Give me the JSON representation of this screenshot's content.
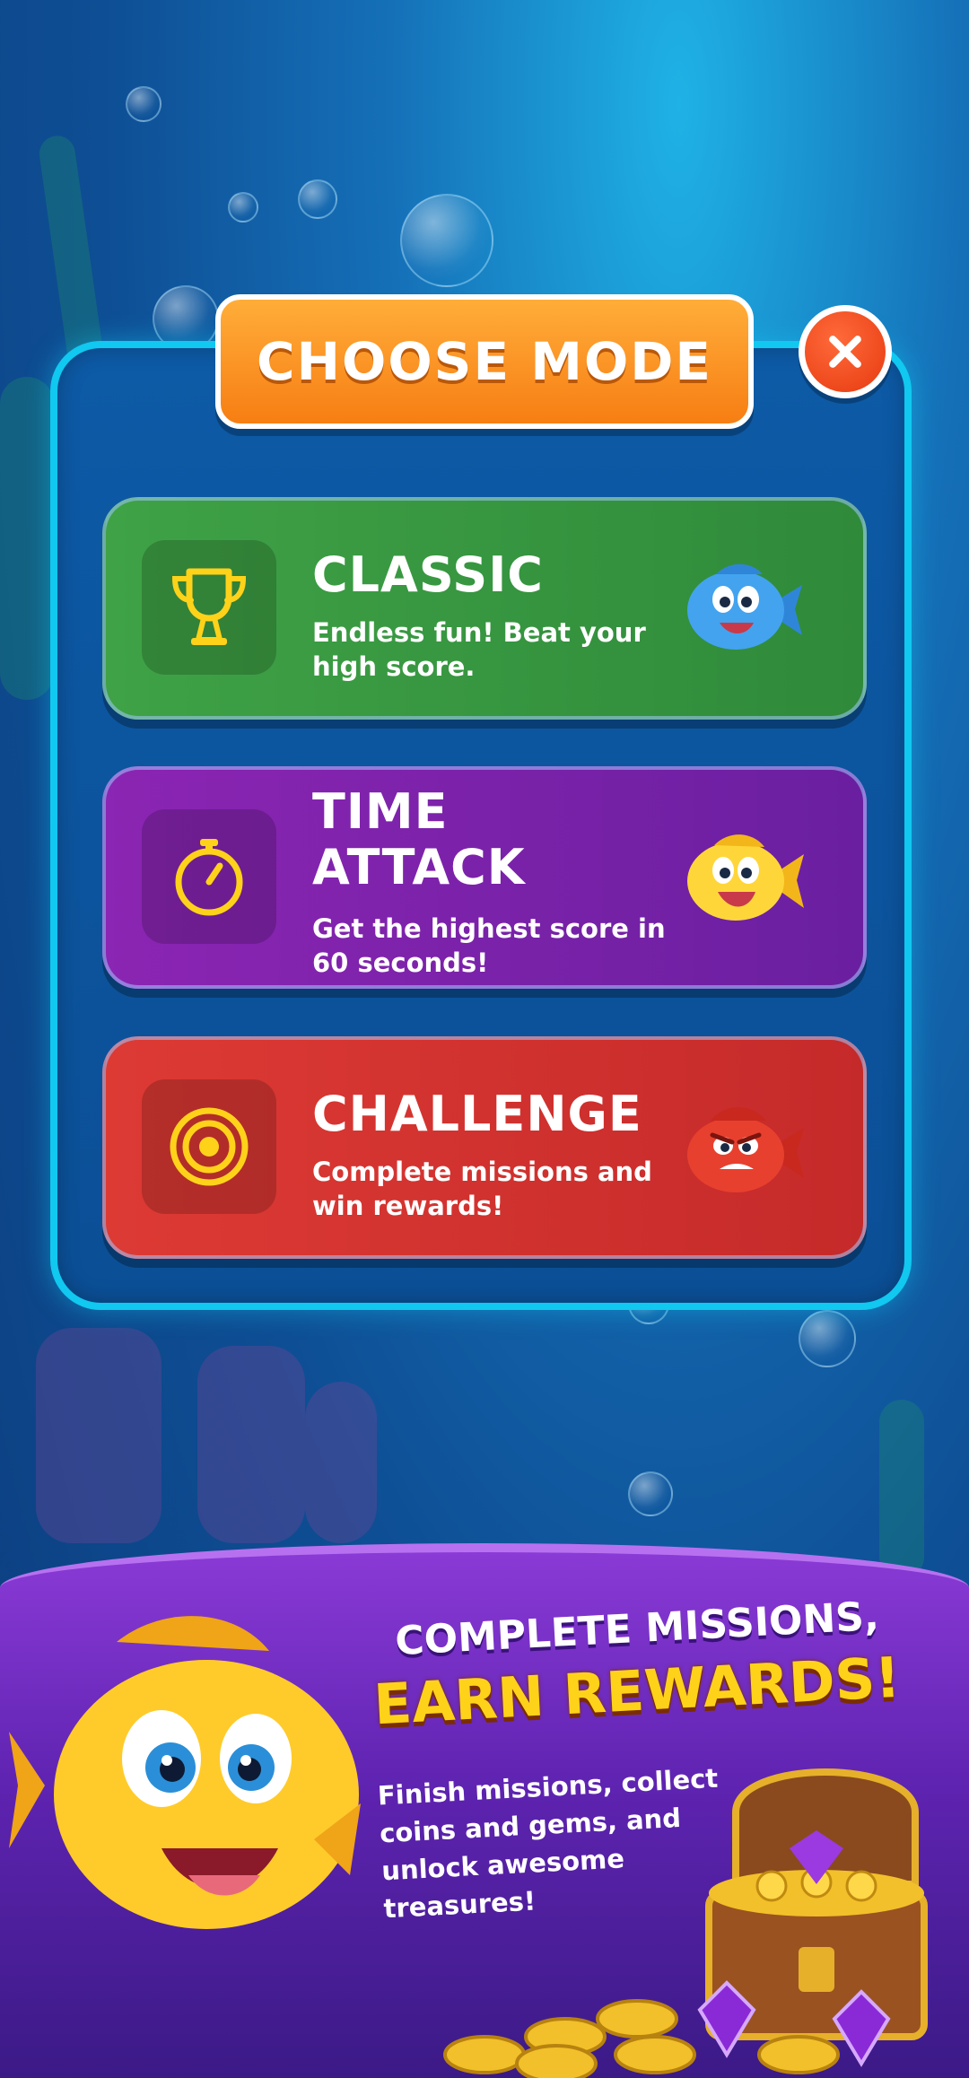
{
  "modal": {
    "title": "CHOOSE MODE",
    "close_icon": "close-icon"
  },
  "modes": [
    {
      "key": "classic",
      "title": "CLASSIC",
      "description": "Endless fun! Beat your high score.",
      "icon": "trophy-icon",
      "fish": "blue-fish",
      "color": "#3fa246"
    },
    {
      "key": "time",
      "title": "TIME\nATTACK",
      "description": "Get the highest score in 60 seconds!",
      "icon": "stopwatch-icon",
      "fish": "yellow-fish",
      "color": "#8b25b3"
    },
    {
      "key": "challenge",
      "title": "CHALLENGE",
      "description": "Complete missions and win rewards!",
      "icon": "target-icon",
      "fish": "red-fish",
      "color": "#dd3a34"
    }
  ],
  "banner": {
    "subtitle": "COMPLETE MISSIONS,",
    "headline": "EARN REWARDS!",
    "text": "Finish missions, collect coins and gems, and unlock awesome treasures!"
  },
  "colors": {
    "accent": "#10c8f0",
    "title_orange": "#f77e13",
    "icon_yellow": "#ffd21a",
    "close_red": "#e63a10"
  }
}
